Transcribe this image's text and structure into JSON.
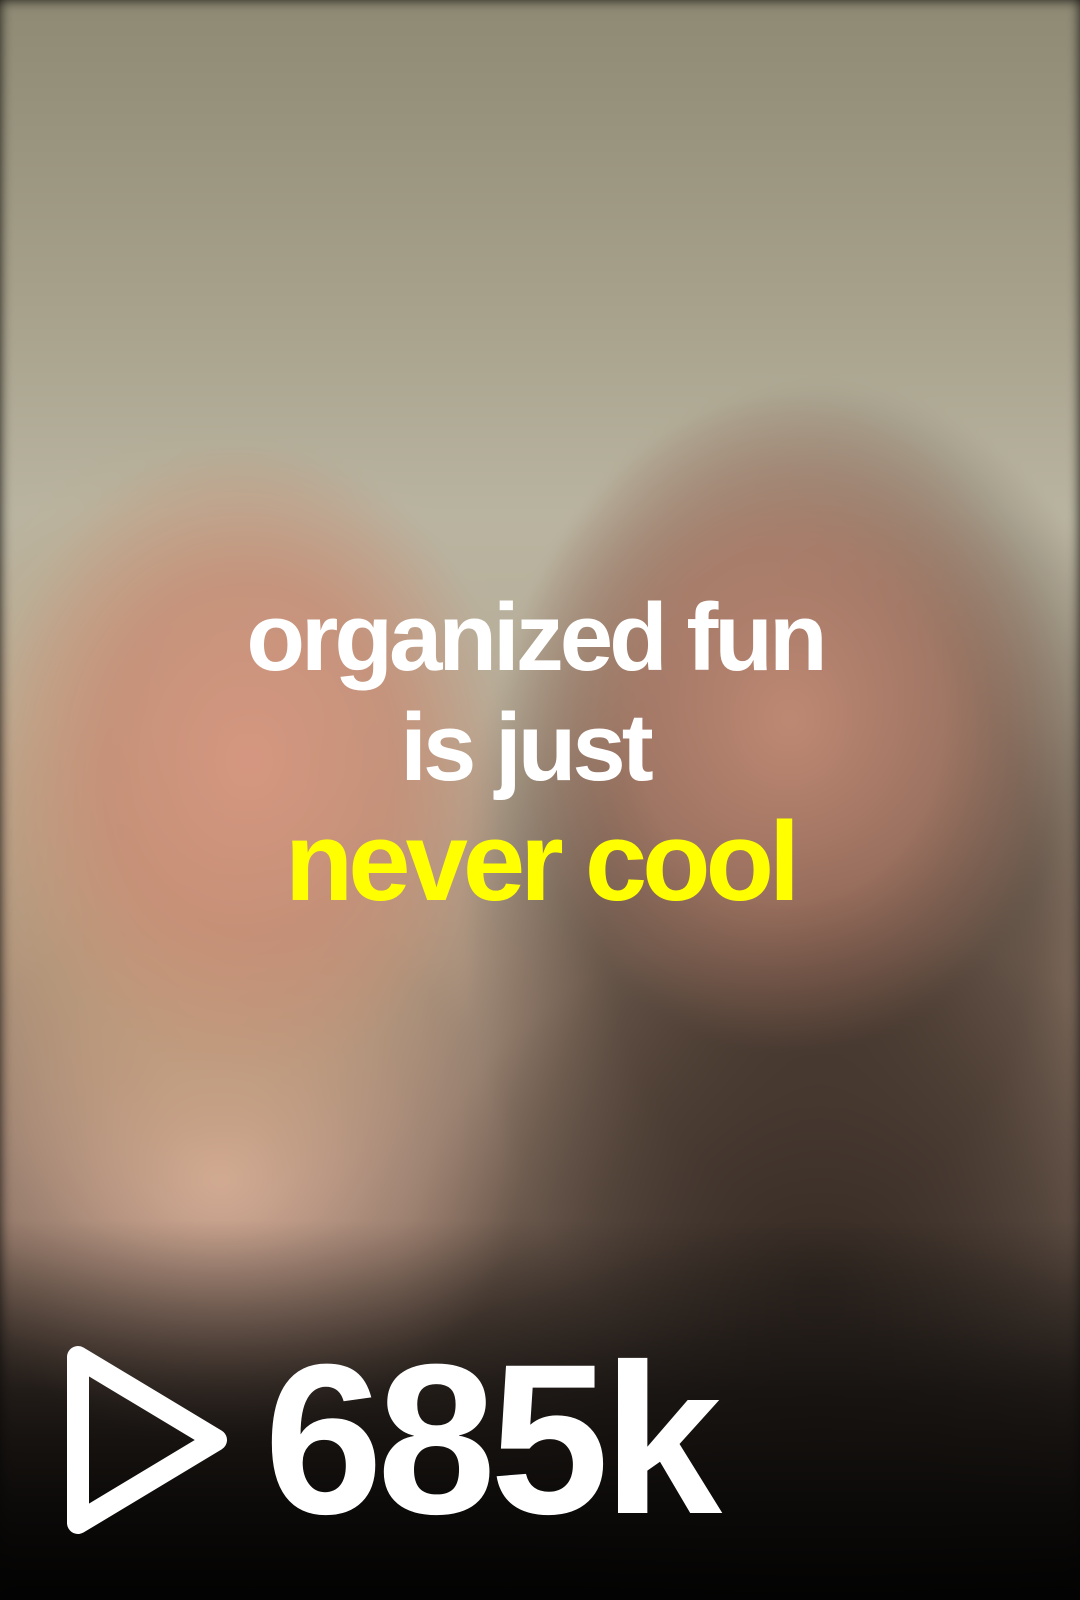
{
  "caption": {
    "line1": "organized fun",
    "line2": "is just",
    "line3": "never cool"
  },
  "stats": {
    "play_icon": "play-outline-icon",
    "view_count": "685k"
  },
  "colors": {
    "caption_text": "#ffffff",
    "caption_highlight": "#ffff00",
    "stats_text": "#ffffff"
  }
}
